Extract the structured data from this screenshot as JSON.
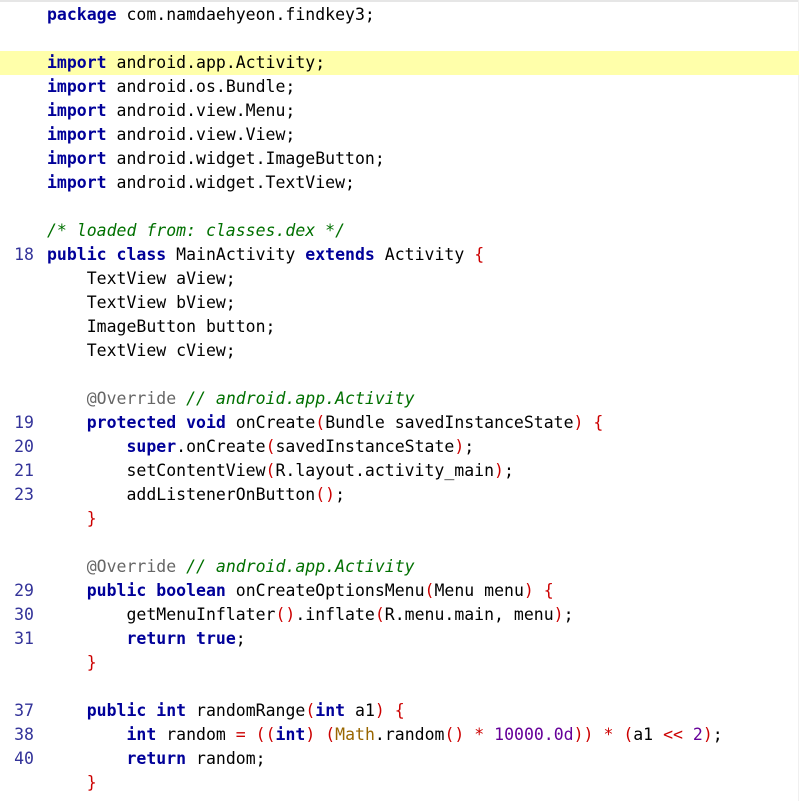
{
  "editor": {
    "highlighted_line_index": 2,
    "lines": [
      {
        "ln": "",
        "tokens": [
          {
            "t": "package",
            "c": "kw"
          },
          {
            "t": " com.namdaehyeon.findkey3;",
            "c": "plain"
          }
        ]
      },
      {
        "ln": "",
        "tokens": []
      },
      {
        "ln": "",
        "tokens": [
          {
            "t": "import",
            "c": "kw"
          },
          {
            "t": " android.app.Activity;",
            "c": "plain"
          }
        ]
      },
      {
        "ln": "",
        "tokens": [
          {
            "t": "import",
            "c": "kw"
          },
          {
            "t": " android.os.Bundle;",
            "c": "plain"
          }
        ]
      },
      {
        "ln": "",
        "tokens": [
          {
            "t": "import",
            "c": "kw"
          },
          {
            "t": " android.view.Menu;",
            "c": "plain"
          }
        ]
      },
      {
        "ln": "",
        "tokens": [
          {
            "t": "import",
            "c": "kw"
          },
          {
            "t": " android.view.View;",
            "c": "plain"
          }
        ]
      },
      {
        "ln": "",
        "tokens": [
          {
            "t": "import",
            "c": "kw"
          },
          {
            "t": " android.widget.ImageButton;",
            "c": "plain"
          }
        ]
      },
      {
        "ln": "",
        "tokens": [
          {
            "t": "import",
            "c": "kw"
          },
          {
            "t": " android.widget.TextView;",
            "c": "plain"
          }
        ]
      },
      {
        "ln": "",
        "tokens": []
      },
      {
        "ln": "",
        "tokens": [
          {
            "t": "/* loaded from: classes.dex */",
            "c": "cm"
          }
        ]
      },
      {
        "ln": "18",
        "tokens": [
          {
            "t": "public",
            "c": "kw"
          },
          {
            "t": " ",
            "c": "plain"
          },
          {
            "t": "class",
            "c": "kw"
          },
          {
            "t": " MainActivity ",
            "c": "plain"
          },
          {
            "t": "extends",
            "c": "kw"
          },
          {
            "t": " Activity ",
            "c": "plain"
          },
          {
            "t": "{",
            "c": "br"
          }
        ]
      },
      {
        "ln": "",
        "tokens": [
          {
            "t": "    TextView aView;",
            "c": "plain"
          }
        ]
      },
      {
        "ln": "",
        "tokens": [
          {
            "t": "    TextView bView;",
            "c": "plain"
          }
        ]
      },
      {
        "ln": "",
        "tokens": [
          {
            "t": "    ImageButton button;",
            "c": "plain"
          }
        ]
      },
      {
        "ln": "",
        "tokens": [
          {
            "t": "    TextView cView;",
            "c": "plain"
          }
        ]
      },
      {
        "ln": "",
        "tokens": []
      },
      {
        "ln": "",
        "tokens": [
          {
            "t": "    ",
            "c": "plain"
          },
          {
            "t": "@Override",
            "c": "ann"
          },
          {
            "t": " // android.app.Activity",
            "c": "cm"
          }
        ]
      },
      {
        "ln": "19",
        "tokens": [
          {
            "t": "    ",
            "c": "plain"
          },
          {
            "t": "protected",
            "c": "kw"
          },
          {
            "t": " ",
            "c": "plain"
          },
          {
            "t": "void",
            "c": "ty"
          },
          {
            "t": " onCreate",
            "c": "plain"
          },
          {
            "t": "(",
            "c": "br"
          },
          {
            "t": "Bundle savedInstanceState",
            "c": "plain"
          },
          {
            "t": ")",
            "c": "br"
          },
          {
            "t": " ",
            "c": "plain"
          },
          {
            "t": "{",
            "c": "br"
          }
        ]
      },
      {
        "ln": "20",
        "tokens": [
          {
            "t": "        ",
            "c": "plain"
          },
          {
            "t": "super",
            "c": "kw"
          },
          {
            "t": ".onCreate",
            "c": "plain"
          },
          {
            "t": "(",
            "c": "br"
          },
          {
            "t": "savedInstanceState",
            "c": "plain"
          },
          {
            "t": ")",
            "c": "br"
          },
          {
            "t": ";",
            "c": "plain"
          }
        ]
      },
      {
        "ln": "21",
        "tokens": [
          {
            "t": "        setContentView",
            "c": "plain"
          },
          {
            "t": "(",
            "c": "br"
          },
          {
            "t": "R.layout.activity_main",
            "c": "plain"
          },
          {
            "t": ")",
            "c": "br"
          },
          {
            "t": ";",
            "c": "plain"
          }
        ]
      },
      {
        "ln": "23",
        "tokens": [
          {
            "t": "        addListenerOnButton",
            "c": "plain"
          },
          {
            "t": "()",
            "c": "br"
          },
          {
            "t": ";",
            "c": "plain"
          }
        ]
      },
      {
        "ln": "",
        "tokens": [
          {
            "t": "    ",
            "c": "plain"
          },
          {
            "t": "}",
            "c": "br"
          }
        ]
      },
      {
        "ln": "",
        "tokens": []
      },
      {
        "ln": "",
        "tokens": [
          {
            "t": "    ",
            "c": "plain"
          },
          {
            "t": "@Override",
            "c": "ann"
          },
          {
            "t": " // android.app.Activity",
            "c": "cm"
          }
        ]
      },
      {
        "ln": "29",
        "tokens": [
          {
            "t": "    ",
            "c": "plain"
          },
          {
            "t": "public",
            "c": "kw"
          },
          {
            "t": " ",
            "c": "plain"
          },
          {
            "t": "boolean",
            "c": "ty"
          },
          {
            "t": " onCreateOptionsMenu",
            "c": "plain"
          },
          {
            "t": "(",
            "c": "br"
          },
          {
            "t": "Menu menu",
            "c": "plain"
          },
          {
            "t": ")",
            "c": "br"
          },
          {
            "t": " ",
            "c": "plain"
          },
          {
            "t": "{",
            "c": "br"
          }
        ]
      },
      {
        "ln": "30",
        "tokens": [
          {
            "t": "        getMenuInflater",
            "c": "plain"
          },
          {
            "t": "()",
            "c": "br"
          },
          {
            "t": ".inflate",
            "c": "plain"
          },
          {
            "t": "(",
            "c": "br"
          },
          {
            "t": "R.menu.main, menu",
            "c": "plain"
          },
          {
            "t": ")",
            "c": "br"
          },
          {
            "t": ";",
            "c": "plain"
          }
        ]
      },
      {
        "ln": "31",
        "tokens": [
          {
            "t": "        ",
            "c": "plain"
          },
          {
            "t": "return",
            "c": "kw"
          },
          {
            "t": " ",
            "c": "plain"
          },
          {
            "t": "true",
            "c": "kw"
          },
          {
            "t": ";",
            "c": "plain"
          }
        ]
      },
      {
        "ln": "",
        "tokens": [
          {
            "t": "    ",
            "c": "plain"
          },
          {
            "t": "}",
            "c": "br"
          }
        ]
      },
      {
        "ln": "",
        "tokens": []
      },
      {
        "ln": "37",
        "tokens": [
          {
            "t": "    ",
            "c": "plain"
          },
          {
            "t": "public",
            "c": "kw"
          },
          {
            "t": " ",
            "c": "plain"
          },
          {
            "t": "int",
            "c": "ty"
          },
          {
            "t": " randomRange",
            "c": "plain"
          },
          {
            "t": "(",
            "c": "br"
          },
          {
            "t": "int",
            "c": "ty"
          },
          {
            "t": " a1",
            "c": "plain"
          },
          {
            "t": ")",
            "c": "br"
          },
          {
            "t": " ",
            "c": "plain"
          },
          {
            "t": "{",
            "c": "br"
          }
        ]
      },
      {
        "ln": "38",
        "tokens": [
          {
            "t": "        ",
            "c": "plain"
          },
          {
            "t": "int",
            "c": "ty"
          },
          {
            "t": " random ",
            "c": "plain"
          },
          {
            "t": "=",
            "c": "br"
          },
          {
            "t": " ",
            "c": "plain"
          },
          {
            "t": "((",
            "c": "br"
          },
          {
            "t": "int",
            "c": "ty"
          },
          {
            "t": ")",
            "c": "br"
          },
          {
            "t": " ",
            "c": "plain"
          },
          {
            "t": "(",
            "c": "br"
          },
          {
            "t": "Math",
            "c": "mcls"
          },
          {
            "t": ".random",
            "c": "plain"
          },
          {
            "t": "()",
            "c": "br"
          },
          {
            "t": " ",
            "c": "plain"
          },
          {
            "t": "*",
            "c": "br"
          },
          {
            "t": " ",
            "c": "plain"
          },
          {
            "t": "10000.0d",
            "c": "num"
          },
          {
            "t": "))",
            "c": "br"
          },
          {
            "t": " ",
            "c": "plain"
          },
          {
            "t": "*",
            "c": "br"
          },
          {
            "t": " ",
            "c": "plain"
          },
          {
            "t": "(",
            "c": "br"
          },
          {
            "t": "a1 ",
            "c": "plain"
          },
          {
            "t": "<<",
            "c": "br"
          },
          {
            "t": " ",
            "c": "plain"
          },
          {
            "t": "2",
            "c": "num"
          },
          {
            "t": ")",
            "c": "br"
          },
          {
            "t": ";",
            "c": "plain"
          }
        ]
      },
      {
        "ln": "40",
        "tokens": [
          {
            "t": "        ",
            "c": "plain"
          },
          {
            "t": "return",
            "c": "kw"
          },
          {
            "t": " random;",
            "c": "plain"
          }
        ]
      },
      {
        "ln": "",
        "tokens": [
          {
            "t": "    ",
            "c": "plain"
          },
          {
            "t": "}",
            "c": "br"
          }
        ]
      }
    ]
  }
}
